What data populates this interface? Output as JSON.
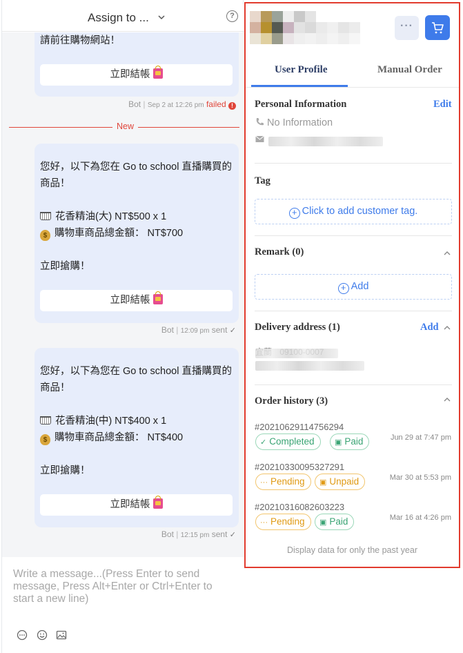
{
  "chat": {
    "header": {
      "assign_label": "Assign to ...",
      "help_glyph": "?"
    },
    "messages": [
      {
        "text": "請前往購物網站！",
        "button_label": "立即結帳",
        "sender": "Bot",
        "time": "Sep 2 at 12:26 pm",
        "status": "failed"
      },
      {
        "text": "您好，以下為您在 Go to school 直播購買的商品！",
        "item_line": "花香精油(大) NT$500 x 1",
        "total_line": "購物車商品總金額： NT$700",
        "cta_line": "立即搶購！",
        "button_label": "立即結帳",
        "sender": "Bot",
        "time": "12:09 pm",
        "status": "sent"
      },
      {
        "text": "您好，以下為您在 Go to school 直播購買的商品！",
        "item_line": "花香精油(中) NT$400 x 1",
        "total_line": "購物車商品總金額： NT$400",
        "cta_line": "立即搶購！",
        "button_label": "立即結帳",
        "sender": "Bot",
        "time": "12:15 pm",
        "status": "sent"
      }
    ],
    "new_divider_label": "New",
    "composer": {
      "placeholder": "Write a message...(Press Enter to send message, Press Alt+Enter or Ctrl+Enter to start a new line)",
      "tools": [
        "chat-bubble-icon",
        "emoji-icon",
        "image-icon"
      ]
    }
  },
  "profile": {
    "header": {
      "more_glyph": "···",
      "cart_icon": "cart-icon"
    },
    "tabs": [
      {
        "label": "User Profile",
        "active": true
      },
      {
        "label": "Manual Order",
        "active": false
      }
    ],
    "personal": {
      "title": "Personal Information",
      "edit_label": "Edit",
      "phone": "No Information"
    },
    "tag": {
      "title": "Tag",
      "add_label": "Click to add customer tag."
    },
    "remark": {
      "title": "Remark (0)",
      "add_label": "Add"
    },
    "delivery": {
      "title": "Delivery address (1)",
      "add_label": "Add",
      "address_prefix": "宜蘭",
      "address_number": "09100-0007"
    },
    "orders": {
      "title": "Order history (3)",
      "items": [
        {
          "id": "#20210629114756294",
          "status": "Completed",
          "payment": "Paid",
          "date": "Jun 29 at 7:47 pm"
        },
        {
          "id": "#20210330095327291",
          "status": "Pending",
          "payment": "Unpaid",
          "date": "Mar 30 at 5:53 pm"
        },
        {
          "id": "#20210316082603223",
          "status": "Pending",
          "payment": "Paid",
          "date": "Mar 16 at 4:26 pm"
        }
      ],
      "footer": "Display data for only the past year"
    },
    "colors": {
      "accent": "#3e7bea",
      "highlight_border": "#e23b2e",
      "green": "#3aa474",
      "orange": "#e09a14",
      "error": "#e0453a"
    }
  }
}
